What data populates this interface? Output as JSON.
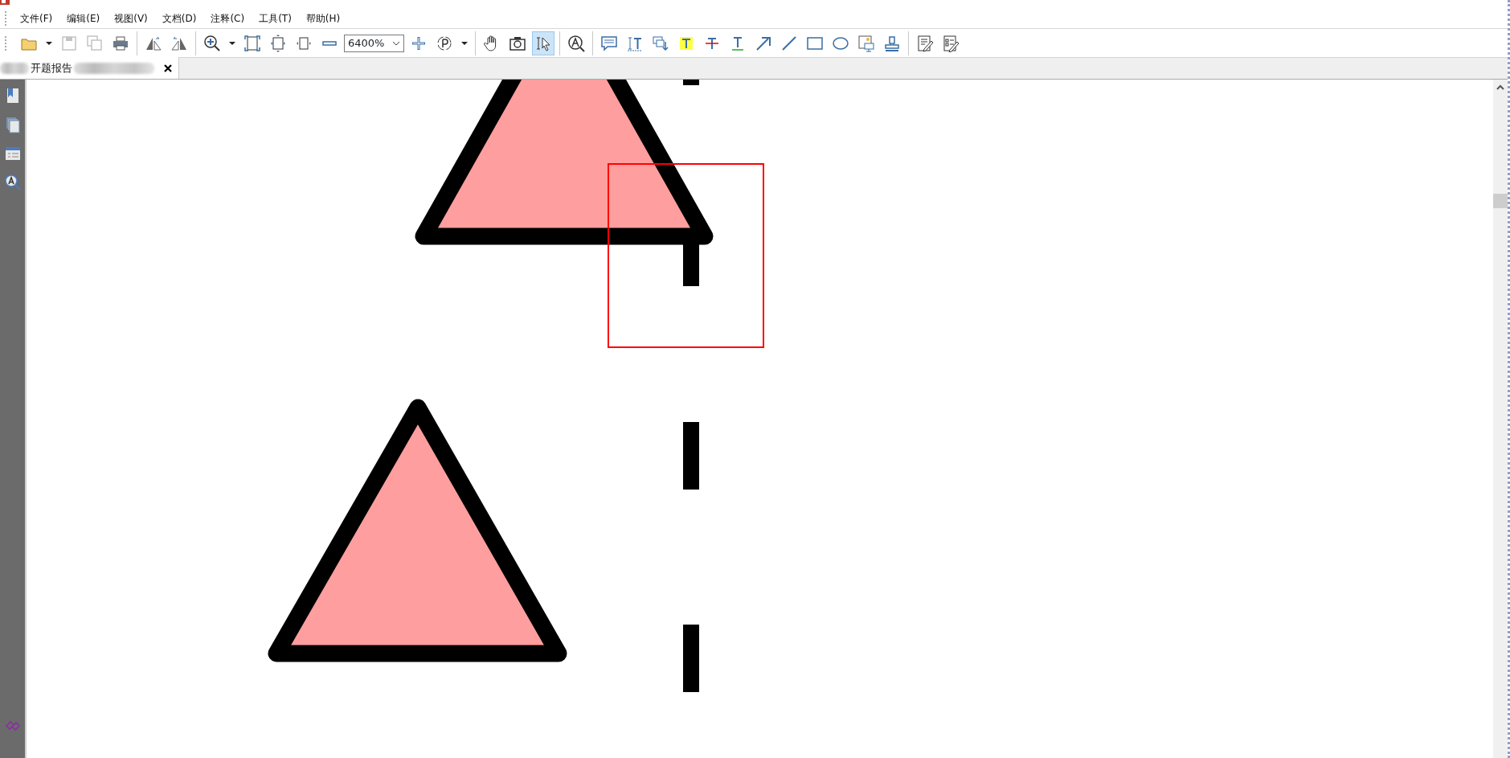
{
  "menu": [
    "文件(F)",
    "编辑(E)",
    "视图(V)",
    "文档(D)",
    "注释(C)",
    "工具(T)",
    "帮助(H)"
  ],
  "toolbar": {
    "groups": [
      [
        {
          "kind": "open",
          "selected": false,
          "disabled": false
        },
        {
          "kind": "caret",
          "selected": false,
          "disabled": false
        },
        {
          "kind": "save",
          "selected": false,
          "disabled": true
        },
        {
          "kind": "save-all",
          "selected": false,
          "disabled": true
        },
        {
          "kind": "print",
          "selected": false,
          "disabled": false
        }
      ],
      [
        {
          "kind": "flip-left",
          "selected": false,
          "disabled": false
        },
        {
          "kind": "flip-right",
          "selected": false,
          "disabled": false
        }
      ],
      [
        {
          "kind": "zoom-in",
          "selected": false,
          "disabled": false
        },
        {
          "kind": "caret",
          "selected": false,
          "disabled": false
        },
        {
          "kind": "fit-page",
          "selected": false,
          "disabled": false
        },
        {
          "kind": "fit-height",
          "selected": false,
          "disabled": false
        },
        {
          "kind": "fit-width",
          "selected": false,
          "disabled": false
        },
        {
          "kind": "minus",
          "selected": false,
          "disabled": false
        },
        {
          "kind": "zoom-field",
          "value": "6400%"
        },
        {
          "kind": "plus",
          "selected": false,
          "disabled": false
        },
        {
          "kind": "rotate",
          "selected": false,
          "disabled": false
        },
        {
          "kind": "caret",
          "selected": false,
          "disabled": false
        }
      ],
      [
        {
          "kind": "hand",
          "selected": false,
          "disabled": false
        },
        {
          "kind": "camera",
          "selected": false,
          "disabled": false
        },
        {
          "kind": "select",
          "selected": true,
          "disabled": false
        }
      ],
      [
        {
          "kind": "find",
          "selected": false,
          "disabled": false
        }
      ],
      [
        {
          "kind": "comment",
          "selected": false,
          "disabled": false
        },
        {
          "kind": "insert-text",
          "selected": false,
          "disabled": false
        },
        {
          "kind": "replace-text",
          "selected": false,
          "disabled": false
        },
        {
          "kind": "highlight",
          "selected": false,
          "disabled": false
        },
        {
          "kind": "strikeout",
          "selected": false,
          "disabled": false
        },
        {
          "kind": "underline",
          "selected": false,
          "disabled": false
        },
        {
          "kind": "arrow",
          "selected": false,
          "disabled": false
        },
        {
          "kind": "line",
          "selected": false,
          "disabled": false
        },
        {
          "kind": "rectangle",
          "selected": false,
          "disabled": false
        },
        {
          "kind": "ellipse",
          "selected": false,
          "disabled": false
        },
        {
          "kind": "image",
          "selected": false,
          "disabled": false
        },
        {
          "kind": "stamp",
          "selected": false,
          "disabled": false
        }
      ],
      [
        {
          "kind": "edit",
          "selected": false,
          "disabled": false
        },
        {
          "kind": "form",
          "selected": false,
          "disabled": false
        }
      ]
    ]
  },
  "tabs": [
    {
      "label": "开题报告",
      "selected": true
    }
  ],
  "sidebar": {
    "items": [
      {
        "kind": "bookmark"
      },
      {
        "kind": "pages"
      },
      {
        "kind": "layers"
      },
      {
        "kind": "search"
      }
    ],
    "bottom_items": [
      {
        "kind": "link"
      }
    ]
  }
}
